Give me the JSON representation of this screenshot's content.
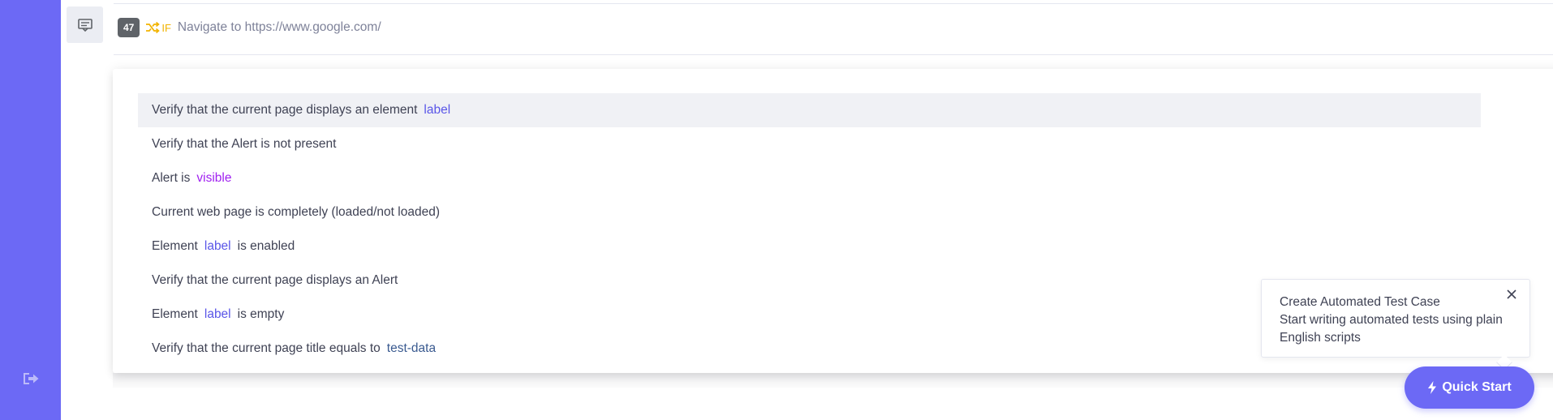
{
  "sidebar": {
    "logout_icon": "logout-icon",
    "color": "#6C69F5"
  },
  "step": {
    "icon": "comment-icon",
    "number": "47",
    "condition_icon": "shuffle-icon",
    "condition": "IF",
    "text": "Navigate to https://www.google.com/"
  },
  "suggestions": [
    {
      "text": "Verify that the current page displays an element",
      "token": "label",
      "after": ""
    },
    {
      "text": "Verify that the Alert is not present",
      "token": "",
      "after": ""
    },
    {
      "text": "Alert is",
      "token": "visible",
      "after": ""
    },
    {
      "text": "Current web page is completely (loaded/not loaded)",
      "token": "",
      "after": ""
    },
    {
      "text": "Element",
      "token": "label",
      "after": "is enabled"
    },
    {
      "text": "Verify that the current page displays an Alert",
      "token": "",
      "after": ""
    },
    {
      "text": "Element",
      "token": "label",
      "after": "is empty"
    },
    {
      "text": "Verify that the current page title equals to",
      "token": "test-data",
      "after": ""
    }
  ],
  "tooltip": {
    "line1": "Create Automated Test Case",
    "line2": "Start writing automated tests using plain English scripts",
    "close_icon": "close-icon"
  },
  "quick_start": {
    "icon": "bolt-icon",
    "label": "Quick Start"
  },
  "colors": {
    "accent": "#6C69F5",
    "token_label": "#5a56e8",
    "token_visible": "#a020f0",
    "token_data": "#3a5a90",
    "if_color": "#f2b300"
  }
}
